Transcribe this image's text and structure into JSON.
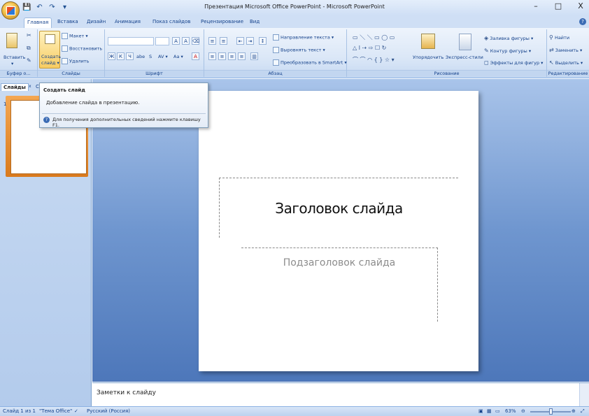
{
  "window": {
    "title": "Презентация Microsoft Office PowerPoint - Microsoft PowerPoint",
    "minimize": "–",
    "maximize": "□",
    "close": "X"
  },
  "qat": {
    "save": "💾",
    "undo": "↶",
    "redo": "↷",
    "customize": "▾"
  },
  "tabs": [
    "Главная",
    "Вставка",
    "Дизайн",
    "Анимация",
    "Показ слайдов",
    "Рецензирование",
    "Вид"
  ],
  "ribbon": {
    "clipboard": {
      "label": "Буфер о...",
      "paste": "Вставить",
      "paste_arrow": "▾"
    },
    "slides": {
      "label": "Слайды",
      "new_slide_line1": "Создать",
      "new_slide_line2": "слайд ▾",
      "layout": "Макет ▾",
      "reset": "Восстановить",
      "delete": "Удалить"
    },
    "font": {
      "label": "Шрифт",
      "bold": "Ж",
      "italic": "К",
      "underline": "Ч",
      "strike": "abe",
      "shadow": "S",
      "spacing": "AV ▾",
      "case": "Aa ▾",
      "color": "A",
      "grow": "A",
      "shrink": "A"
    },
    "paragraph": {
      "label": "Абзац",
      "text_direction": "Направление текста ▾",
      "align_text": "Выровнять текст ▾",
      "smartart": "Преобразовать в SmartArt ▾"
    },
    "drawing": {
      "label": "Рисование",
      "arrange": "Упорядочить",
      "quick_styles": "Экспресс-стили",
      "fill": "Заливка фигуры ▾",
      "outline": "Контур фигуры ▾",
      "effects": "Эффекты для фигур ▾"
    },
    "editing": {
      "label": "Редактирование",
      "find": "Найти",
      "replace": "Заменить ▾",
      "select": "Выделить ▾"
    }
  },
  "left_panel": {
    "tab_slides": "Слайды",
    "tab_outline": "Ст",
    "close": "x",
    "slide_number": "1"
  },
  "tooltip": {
    "title": "Создать слайд",
    "description": "Добавление слайда в презентацию.",
    "help": "Для получения дополнительных сведений нажмите клавишу F1."
  },
  "slide": {
    "title_placeholder": "Заголовок слайда",
    "subtitle_placeholder": "Подзаголовок слайда"
  },
  "notes": {
    "placeholder": "Заметки к слайду"
  },
  "status": {
    "slide_info": "Слайд 1 из 1",
    "theme": "\"Тема Office\"",
    "language": "Русский (Россия)",
    "zoom": "63%",
    "zoom_out": "⊖",
    "zoom_in": "⊕"
  }
}
